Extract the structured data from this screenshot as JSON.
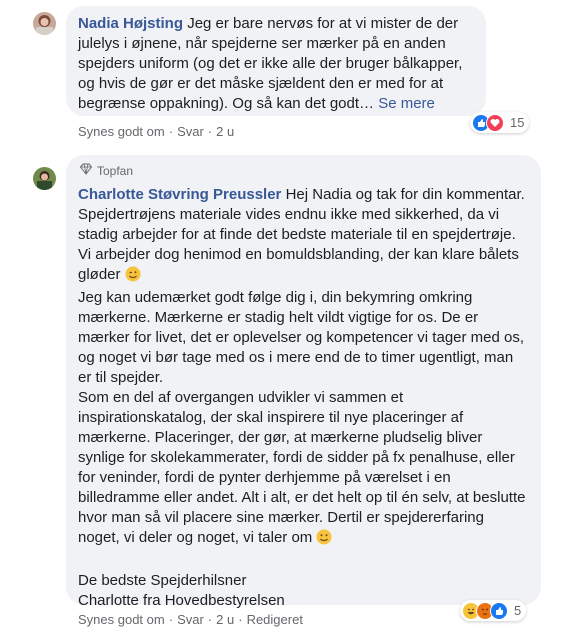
{
  "comment1": {
    "author": "Nadia Højsting",
    "text": "Jeg er bare nervøs for at vi mister de der julelys i øjnene, når spejderne ser mærker på en anden spejders uniform (og det er ikke alle der bruger bålkapper, og hvis de gør er det måske sjældent den er med for at begrænse oppakning). Og så kan det godt…",
    "see_more": "Se mere",
    "actions": {
      "like": "Synes godt om",
      "reply": "Svar",
      "time": "2 u"
    },
    "reactions": {
      "count": "15"
    }
  },
  "comment2": {
    "badge": "Topfan",
    "author": "Charlotte Støvring Preussler",
    "text_p1": "Hej Nadia og tak for din kommentar. Spejdertrøjens materiale vides endnu ikke med sikkerhed, da vi stadig arbejder for at finde det bedste materiale til en spejdertrøje. Vi arbejder dog henimod en bomuldsblanding, der kan klare bålets gløder",
    "text_p2": "Jeg kan udemærket godt følge dig i, din bekymring omkring mærkerne. Mærkerne er stadig helt vildt vigtige for os. De er mærker for livet, det er oplevelser og kompetencer vi tager med os, og noget vi bør tage med os i mere end de to timer ugentligt, man er til spejder.",
    "text_p3": "Som en del af overgangen udvikler vi sammen et inspirationskatalog, der skal inspirere til nye placeringer af mærkerne. Placeringer, der gør, at mærkerne pludselig bliver synlige for skolekammerater, fordi de sidder på fx penalhuse, eller for veninder, fordi de pynter derhjemme på værelset i en billedramme eller andet. Alt i alt, er det helt op til én selv, at beslutte hvor man så vil placere sine mærker. Dertil er spejdererfaring noget, vi deler og noget, vi taler om",
    "signoff1": "De bedste Spejderhilsner",
    "signoff2": "Charlotte fra Hovedbestyrelsen",
    "actions": {
      "like": "Synes godt om",
      "reply": "Svar",
      "time": "2 u",
      "edited": "Redigeret"
    },
    "reactions": {
      "count": "5"
    }
  },
  "colors": {
    "link": "#385898",
    "bubble": "#f0f2f5",
    "meta": "#65676b"
  },
  "icons": [
    "avatar",
    "diamond-icon",
    "like-reaction-icon",
    "love-reaction-icon",
    "haha-reaction-icon",
    "angry-reaction-icon",
    "wink-emoji-icon",
    "smile-emoji-icon"
  ]
}
